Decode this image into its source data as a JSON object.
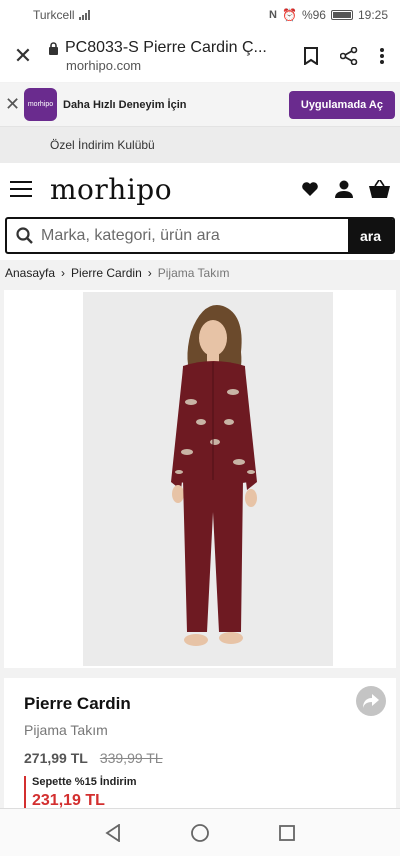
{
  "status": {
    "carrier": "Turkcell",
    "battery": "%96",
    "time": "19:25"
  },
  "browser": {
    "title": "PC8033-S Pierre Cardin Ç...",
    "domain": "morhipo.com"
  },
  "app_banner": {
    "logo_text": "morhipo",
    "text": "Daha Hızlı Deneyim İçin",
    "button": "Uygulamada Aç"
  },
  "club": {
    "text": "Özel İndirim Kulübü"
  },
  "header": {
    "logo": "morhipo"
  },
  "search": {
    "placeholder": "Marka, kategori, ürün ara",
    "button": "ara"
  },
  "breadcrumb": {
    "items": [
      "Anasayfa",
      "Pierre Cardin"
    ],
    "current": "Pijama Takım",
    "separator": "›"
  },
  "product": {
    "brand": "Pierre Cardin",
    "type": "Pijama Takım",
    "price": "271,99 TL",
    "old_price": "339,99 TL",
    "promo_label": "Sepette %15 İndirim",
    "promo_price": "231,19 TL"
  },
  "colors": {
    "accent": "#6a2b8e",
    "promo": "#d32f2f",
    "garment": "#6e1a22"
  },
  "icons": [
    "close-icon",
    "lock-icon",
    "bookmark-icon",
    "share-icon",
    "more-icon",
    "heart-icon",
    "user-icon",
    "basket-icon",
    "search-icon",
    "back-icon",
    "home-icon",
    "recents-icon"
  ]
}
